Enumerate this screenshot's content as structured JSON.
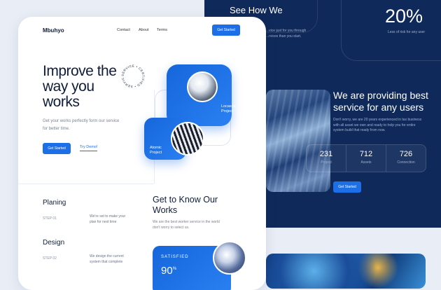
{
  "dark": {
    "see_how_title": "See How We",
    "see_how_sub": "...vice just for you through ...rvices than you start.",
    "percent": "20%",
    "percent_sub": "Less of risk for any user",
    "providing_title": "We are providing best service for any users",
    "providing_sub": "Don't worry, we are 20 years experienced in tax business with all asset we own and ready to help you for entire system build that ready from now.",
    "stats": [
      {
        "value": "231",
        "label": "Project"
      },
      {
        "value": "712",
        "label": "Assets"
      },
      {
        "value": "726",
        "label": "Connection"
      }
    ],
    "cta": "Get Started"
  },
  "header": {
    "logo": "Mbuhyo",
    "nav": [
      "Contact",
      "About",
      "Terms"
    ],
    "cta": "Get Started"
  },
  "hero": {
    "title": "Improve the way you works",
    "subtitle": "Get your works perfectly form our service for better time.",
    "primary_cta": "Get Started",
    "secondary_cta": "Try Demo!",
    "badge_text": "SERVICE • CERTIFIED • SERVICE •",
    "project1": "Locasca Project",
    "project2": "Atomic Project"
  },
  "steps": [
    {
      "title": "Planing",
      "step": "STEP 01",
      "desc": "We're set to make your plan for next time"
    },
    {
      "title": "Design",
      "step": "STEP 02",
      "desc": "We design the current system that complete"
    }
  ],
  "know": {
    "title": "Get to Know Our Works",
    "subtitle": "We are the best worker service in the world don't worry to select us.",
    "satisfied_label": "SATISFIED",
    "satisfied_value": "90",
    "satisfied_unit": "%"
  },
  "colors": {
    "accent": "#1d6fe8",
    "dark": "#0f2a5a",
    "text": "#0f1d3a"
  }
}
